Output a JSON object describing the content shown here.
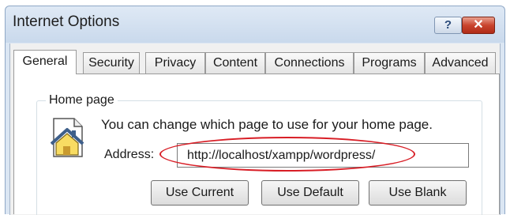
{
  "window": {
    "title": "Internet Options",
    "help_glyph": "?",
    "close_glyph": "✕"
  },
  "tabs": [
    {
      "label": "General",
      "active": true
    },
    {
      "label": "Security",
      "active": false
    },
    {
      "label": "Privacy",
      "active": false
    },
    {
      "label": "Content",
      "active": false
    },
    {
      "label": "Connections",
      "active": false
    },
    {
      "label": "Programs",
      "active": false
    },
    {
      "label": "Advanced",
      "active": false
    }
  ],
  "home_page": {
    "legend": "Home page",
    "icon": "home-page-icon",
    "description": "You can change which page to use for your home page.",
    "address_label": "Address:",
    "address_value": "http://localhost/xampp/wordpress/",
    "highlight_color": "#d81e26",
    "buttons": {
      "use_current": "Use Current",
      "use_default": "Use Default",
      "use_blank": "Use Blank"
    }
  }
}
